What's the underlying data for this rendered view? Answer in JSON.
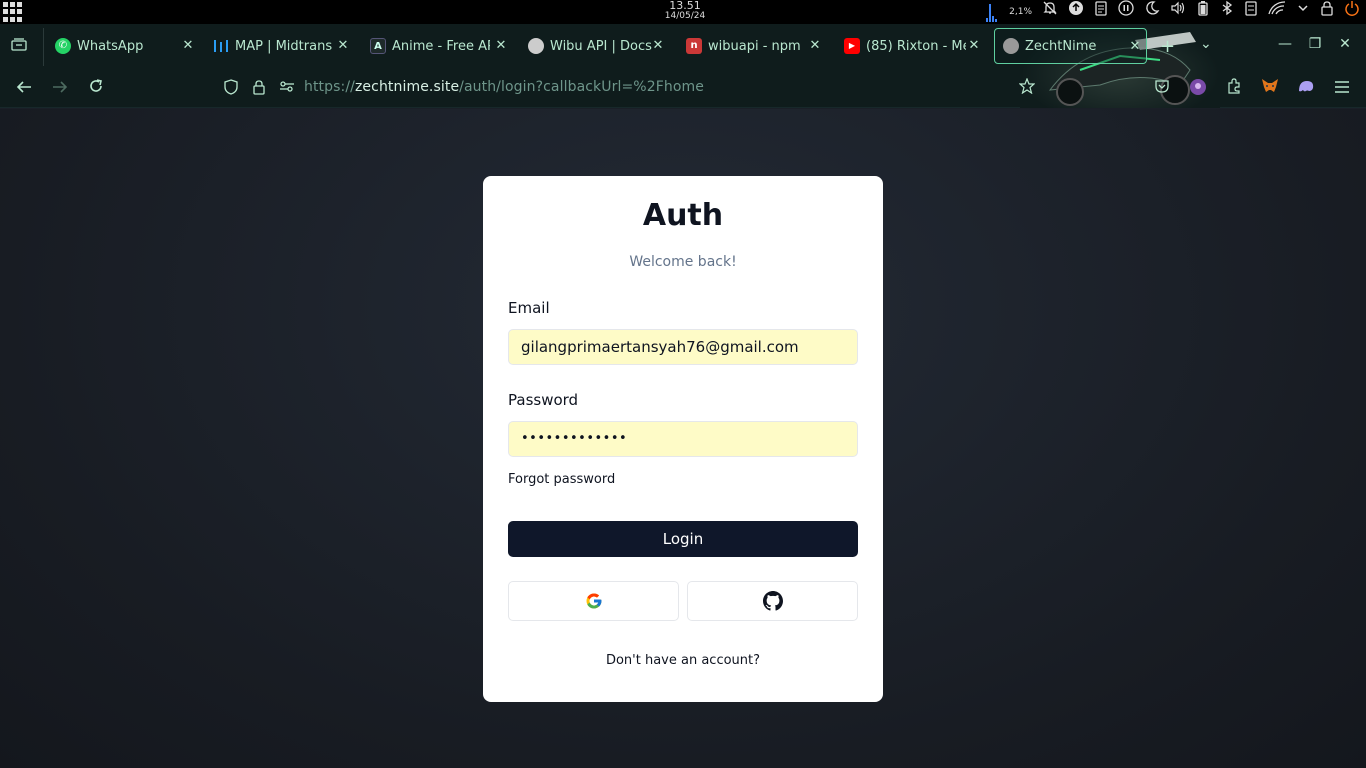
{
  "system_bar": {
    "time": "13.51",
    "date": "14/05/24",
    "cpu_percent": "2,1%",
    "tray_icons": [
      "cpu-graph-icon",
      "notifications-off-icon",
      "update-icon",
      "clipboard-icon",
      "media-icon",
      "night-light-icon",
      "volume-icon",
      "battery-icon",
      "bluetooth-icon",
      "storage-icon",
      "wifi-icon",
      "chevron-down-icon",
      "lock-icon",
      "power-icon"
    ]
  },
  "browser": {
    "tabs": [
      {
        "label": "WhatsApp",
        "icon": "whatsapp-icon",
        "color": "#25d366"
      },
      {
        "label": "MAP | Midtrans",
        "icon": "midtrans-icon",
        "color": "#2a9df4"
      },
      {
        "label": "Anime - Free AP",
        "icon": "anime-api-icon",
        "color": "#1e2a2a"
      },
      {
        "label": "Wibu API | Docs",
        "icon": "wibu-api-icon",
        "color": "#cccccc"
      },
      {
        "label": "wibuapi - npm",
        "icon": "npm-icon",
        "color": "#cb3837"
      },
      {
        "label": "(85) Rixton - Me",
        "icon": "youtube-icon",
        "color": "#ff0000"
      },
      {
        "label": "ZechtNime",
        "icon": "zechtnime-icon",
        "color": "#999999"
      }
    ],
    "address": {
      "prefix": "https://",
      "host": "zechtnime.site",
      "path": "/auth/login?callbackUrl=%2Fhome"
    }
  },
  "auth": {
    "title": "Auth",
    "subtitle": "Welcome back!",
    "email_label": "Email",
    "email_value": "gilangprimaertansyah76@gmail.com",
    "password_label": "Password",
    "password_value": "•••••••••••••",
    "forgot_label": "Forgot password",
    "login_label": "Login",
    "signup_text": "Don't have an account?",
    "providers": [
      "google-icon",
      "github-icon"
    ]
  },
  "colors": {
    "accent": "#0f172a",
    "autofill": "#fefbc7",
    "chrome": "#0f1c1c",
    "chrome_text": "#b9e7cf"
  }
}
